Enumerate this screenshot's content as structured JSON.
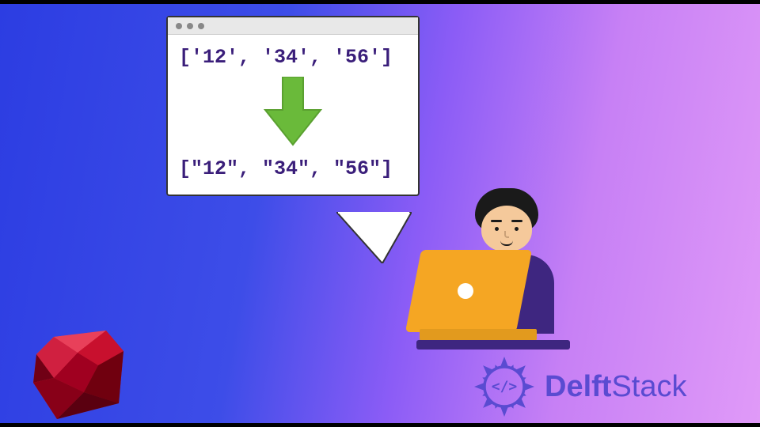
{
  "code": {
    "before": "['12', '34', '56']",
    "after": "[\"12\", \"34\", \"56\"]"
  },
  "brand": {
    "left": "Delft",
    "right": "Stack",
    "symbol": "</>"
  },
  "colors": {
    "arrow": "#6aba3a",
    "code_text": "#3a1e7a",
    "laptop": "#f5a623",
    "shirt": "#3e2680",
    "brand": "#5a4bd1",
    "ruby": "#c8102e"
  }
}
